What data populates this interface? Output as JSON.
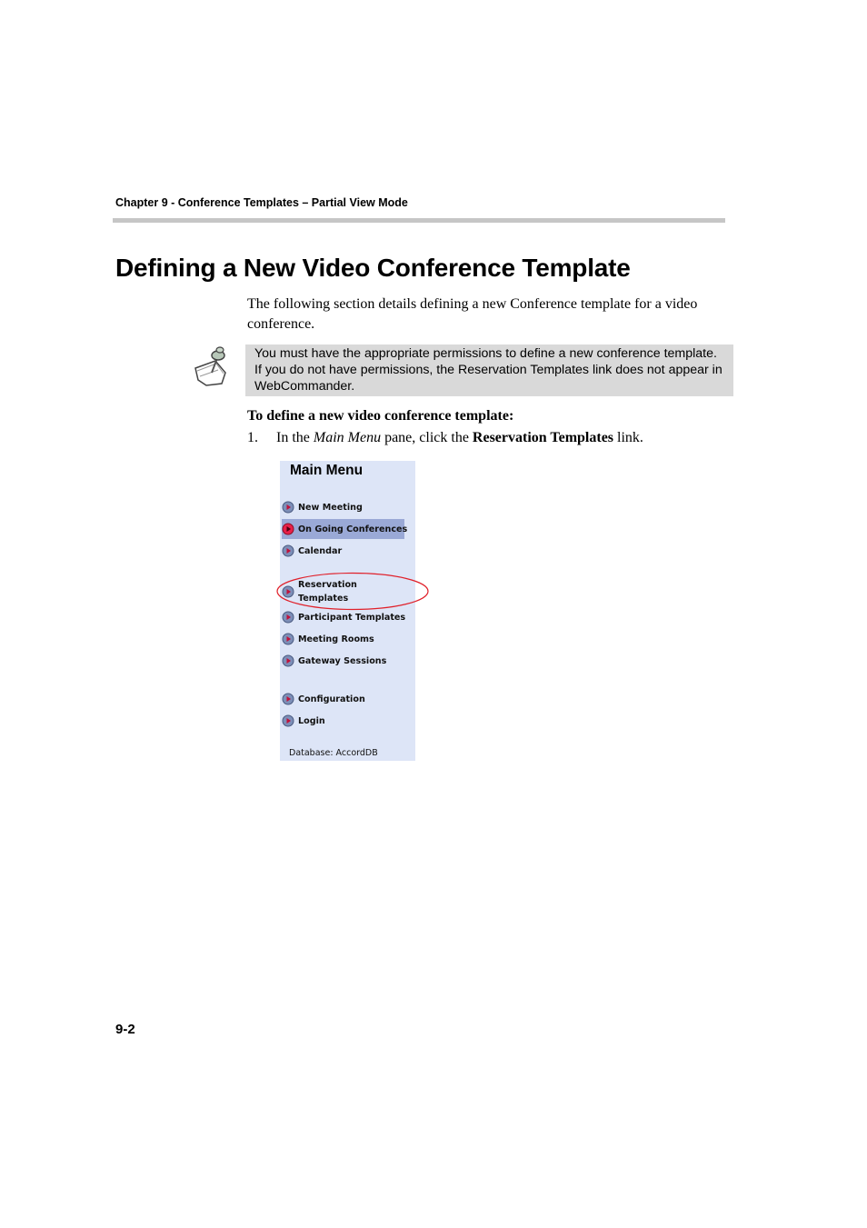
{
  "header": {
    "running_title": "Chapter 9 - Conference Templates – Partial View Mode"
  },
  "section": {
    "title": "Defining a New Video Conference Template",
    "intro": "The following section details defining a new Conference template for a video conference."
  },
  "note": {
    "icon": "note-pin-icon",
    "text": "You must have the appropriate permissions to define a new conference template. If you do not have permissions, the Reservation Templates link does not appear in WebCommander."
  },
  "procedure": {
    "heading": "To define a new video conference template:",
    "steps": [
      {
        "number": "1.",
        "prefix": "In the ",
        "emphasis": "Main Menu",
        "middle": " pane, click the ",
        "strong": "Reservation Templates",
        "suffix": " link."
      }
    ]
  },
  "main_menu": {
    "title": "Main Menu",
    "items": [
      {
        "label": "New Meeting",
        "icon": "arrow-circle-icon"
      },
      {
        "label": "On Going Conferences",
        "icon": "arrow-circle-active-icon",
        "active": true
      },
      {
        "label": "Calendar",
        "icon": "arrow-circle-icon"
      },
      {
        "label": "Reservation Templates",
        "icon": "arrow-circle-icon",
        "highlighted": true
      },
      {
        "label": "Participant Templates",
        "icon": "arrow-circle-icon"
      },
      {
        "label": "Meeting Rooms",
        "icon": "arrow-circle-icon"
      },
      {
        "label": "Gateway Sessions",
        "icon": "arrow-circle-icon"
      },
      {
        "label": "Configuration",
        "icon": "arrow-circle-icon"
      },
      {
        "label": "Login",
        "icon": "arrow-circle-icon"
      }
    ],
    "database_label": "Database: AccordDB"
  },
  "colors": {
    "menu_background": "#dde5f7",
    "active_item": "#9aa9d6",
    "highlight_oval": "#e0202a",
    "note_background": "#d9d9d9"
  },
  "footer": {
    "page_number": "9-2"
  }
}
